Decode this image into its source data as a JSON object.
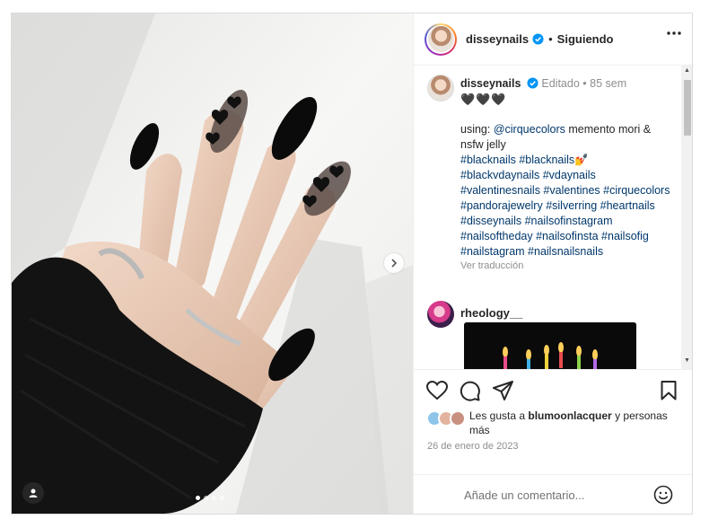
{
  "post": {
    "user": "disseynails",
    "follow_status": "Siguiendo",
    "separator": "•"
  },
  "caption": {
    "user": "disseynails",
    "edited": "Editado",
    "dot": "•",
    "age": "85 sem",
    "hearts": "🖤🖤🖤",
    "text_prefix": "using: ",
    "mention": "@cirquecolors",
    "text_suffix": " memento mori & nsfw jelly",
    "tags_line1": "#blacknails #blacknails💅",
    "tags": "#blackvdaynails #vdaynails #valentinesnails #valentines #cirquecolors #pandorajewelry #silverring #heartnails #disseynails #nailsofinstagram #nailsoftheday #nailsofinsta #nailsofig #nailstagram #nailsnailsnails",
    "translate": "Ver traducción"
  },
  "comment2": {
    "user": "rheology__"
  },
  "likes": {
    "prefix": "Les gusta a ",
    "user": "blumoonlacquer",
    "suffix": " y personas más"
  },
  "date": "26 de enero de 2023",
  "add_comment": {
    "placeholder": "Añade un comentario..."
  },
  "icons": {
    "verified": "verified-badge-icon",
    "more": "more-options-icon",
    "like": "heart-icon",
    "comment": "comment-icon",
    "share": "share-icon",
    "save": "bookmark-icon",
    "emoji": "emoji-icon",
    "next": "chevron-right-icon",
    "tagged": "user-tag-icon"
  },
  "carousel": {
    "slides": 4,
    "active": 1
  },
  "colors": {
    "link": "#00376b",
    "muted": "#8e8e8e",
    "verified": "#0095f6"
  }
}
